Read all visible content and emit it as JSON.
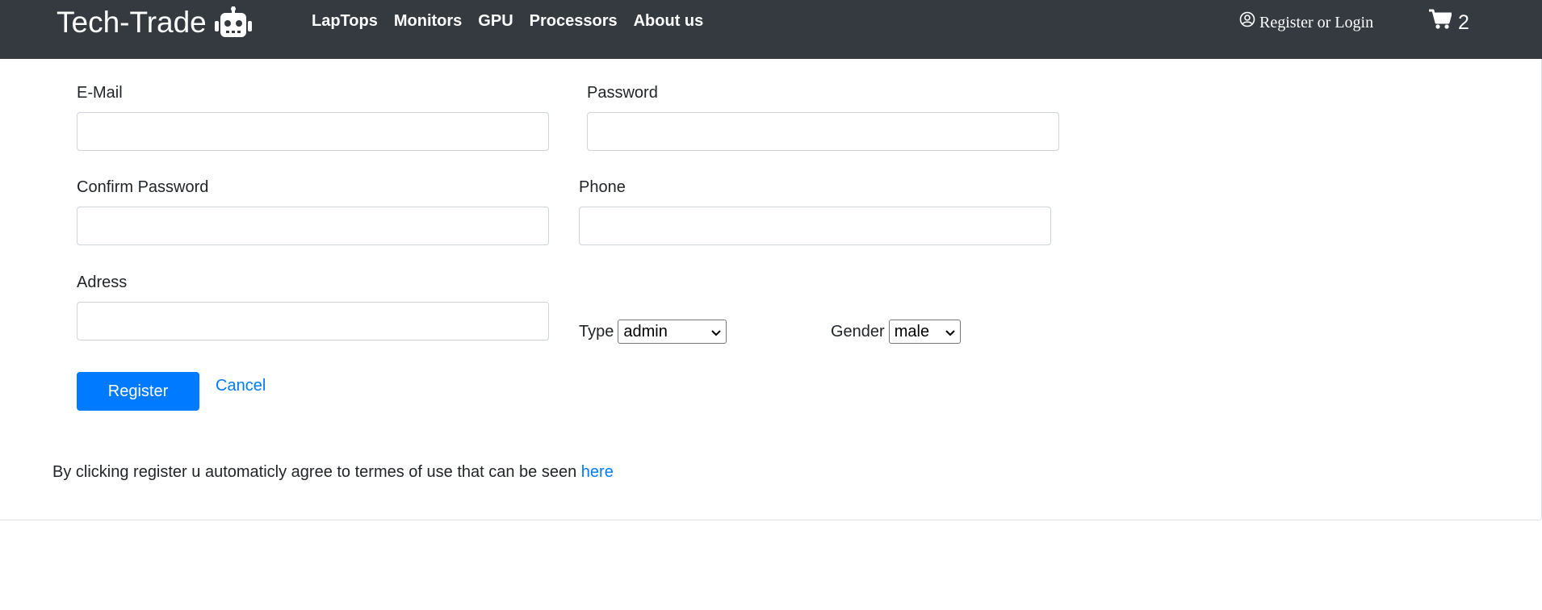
{
  "header": {
    "brand": "Tech-Trade",
    "brand_icon": "robot-icon",
    "nav": [
      "LapTops",
      "Monitors",
      "GPU",
      "Processors",
      "About us"
    ],
    "account_icon": "user-circle-icon",
    "account_label": "Register or Login",
    "cart_icon": "shopping-cart-icon",
    "cart_count": "2"
  },
  "form": {
    "email_label": "E-Mail",
    "email_value": "",
    "password_label": "Password",
    "password_value": "",
    "confirm_label": "Confirm Password",
    "confirm_value": "",
    "phone_label": "Phone",
    "phone_value": "",
    "address_label": "Adress",
    "address_value": "",
    "type_label": "Type",
    "type_value": "admin",
    "gender_label": "Gender",
    "gender_value": "male",
    "register_label": "Register",
    "cancel_label": "Cancel"
  },
  "footer": {
    "terms_text": "By clicking register u automaticly agree to termes of use that can be seen ",
    "terms_link": "here"
  },
  "colors": {
    "navbar": "#343a40",
    "primary": "#007bff"
  }
}
